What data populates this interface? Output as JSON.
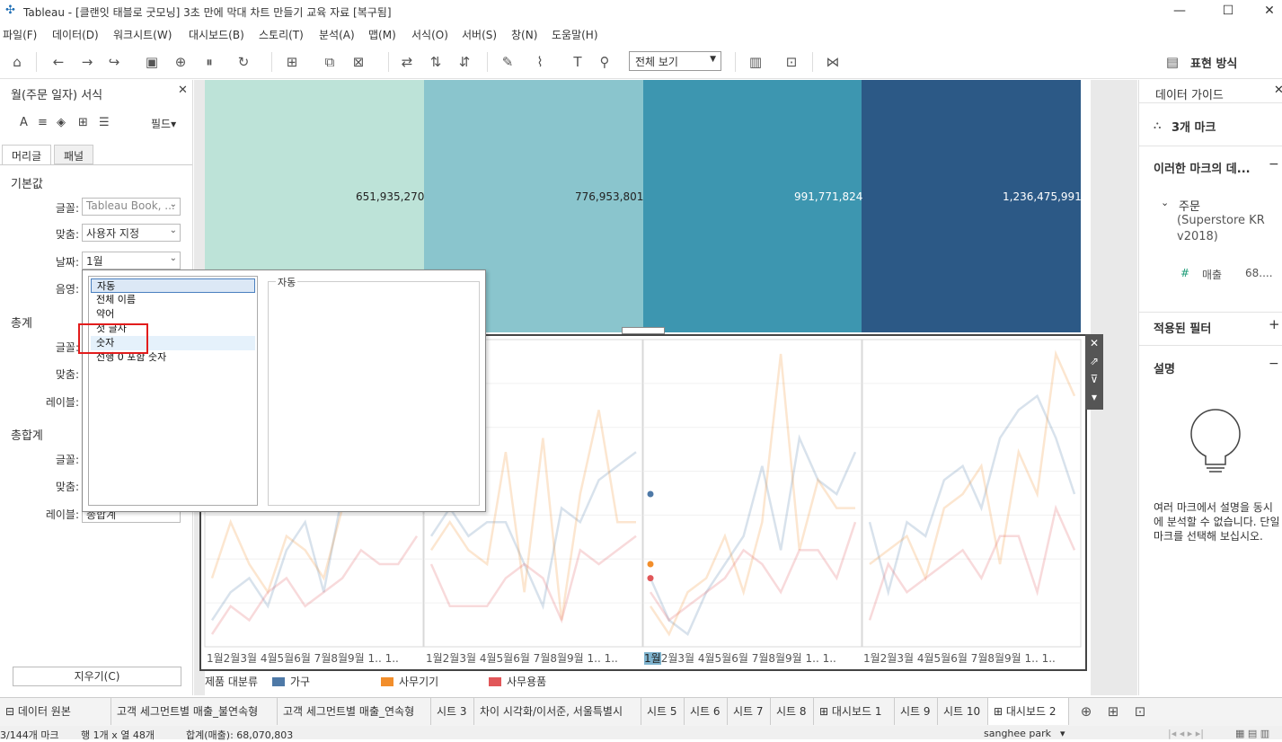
{
  "window": {
    "title": "Tableau - [클랜잇 태블로 굿모닝] 3초 만에 막대 차트 만들기 교육 자료 [복구됨]",
    "minimize": "—",
    "maximize": "☐",
    "close": "✕"
  },
  "menu": [
    "파일(F)",
    "데이터(D)",
    "워크시트(W)",
    "대시보드(B)",
    "스토리(T)",
    "분석(A)",
    "맵(M)",
    "서식(O)",
    "서버(S)",
    "창(N)",
    "도움말(H)"
  ],
  "toolbar": {
    "view_select": "전체 보기",
    "show_me": "표현 방식",
    "icons": [
      "home-icon",
      "undo-icon",
      "redo-icon",
      "redo-forward-icon",
      "save-icon",
      "new-datasource-icon",
      "pause-icon",
      "refresh-icon",
      "new-worksheet-icon",
      "duplicate-icon",
      "clear-icon",
      "swap-icon",
      "sort-asc-icon",
      "sort-desc-icon",
      "highlight-icon",
      "group-icon",
      "label-icon",
      "pin-icon",
      "fit-icon",
      "presentation-icon",
      "share-icon"
    ]
  },
  "format_pane": {
    "title": "월(주문 일자) 서식",
    "field_button": "필드▾",
    "tabs": {
      "header": "머리글",
      "panel": "패널"
    },
    "default_section": "기본값",
    "font_label": "글꼴:",
    "font_value": "Tableau Book, ...",
    "align_label": "맞춤:",
    "align_value": "사용자 지정",
    "date_label": "날짜:",
    "date_value": "1월",
    "shading_label": "음영:",
    "totals_section": "총계",
    "totals_font_label": "글꼴:",
    "totals_align_label": "맞춤:",
    "totals_label_label": "레이블:",
    "grand_section": "총합계",
    "grand_font_label": "글꼴:",
    "grand_align_label": "맞춤:",
    "grand_label_label": "레이블:",
    "grand_label_value": "총합계",
    "clear_button": "지우기(C)"
  },
  "date_dropdown": {
    "options": [
      "자동",
      "전체 이름",
      "약어",
      "첫 글자",
      "숫자",
      "선행 0 포함 숫자"
    ],
    "selected": "자동",
    "preview_caption": "자동"
  },
  "bar_chart": {
    "labels": [
      "651,935,270",
      "776,953,801",
      "991,771,824",
      "1,236,475,991"
    ],
    "colors": [
      "#bde3d8",
      "#8ac5cd",
      "#3d96b0",
      "#2c5986"
    ]
  },
  "chart_data": {
    "type": "line",
    "categories": [
      "1월",
      "2월",
      "3월",
      "4월",
      "5월",
      "6월",
      "7월",
      "8월",
      "9월",
      "1..",
      "1..",
      "1.."
    ],
    "panes": 4,
    "series": [
      {
        "name": "가구",
        "values": [
          [
            1,
            3,
            4,
            2,
            6,
            8,
            3,
            10,
            9,
            12,
            13,
            15
          ],
          [
            7,
            9,
            7,
            8,
            8,
            5,
            2,
            9,
            8,
            11,
            12,
            13
          ],
          [
            4,
            1,
            0,
            3,
            5,
            7,
            12,
            6,
            14,
            11,
            10,
            13
          ],
          [
            8,
            3,
            8,
            7,
            11,
            12,
            9,
            14,
            16,
            17,
            14,
            10
          ]
        ]
      },
      {
        "name": "사무기기",
        "values": [
          [
            4,
            8,
            5,
            3,
            7,
            6,
            4,
            9,
            10,
            14,
            15,
            18
          ],
          [
            6,
            8,
            6,
            5,
            13,
            3,
            14,
            1,
            10,
            16,
            8,
            8
          ],
          [
            2,
            0,
            3,
            4,
            7,
            3,
            8,
            20,
            6,
            11,
            9,
            9
          ],
          [
            5,
            6,
            7,
            4,
            9,
            10,
            12,
            5,
            13,
            10,
            20,
            17
          ]
        ]
      },
      {
        "name": "사무용품",
        "values": [
          [
            0,
            2,
            1,
            3,
            4,
            2,
            3,
            4,
            6,
            5,
            5,
            7
          ],
          [
            5,
            2,
            2,
            2,
            4,
            5,
            4,
            1,
            6,
            5,
            6,
            7
          ],
          [
            3,
            1,
            2,
            3,
            4,
            6,
            5,
            3,
            6,
            6,
            4,
            8
          ],
          [
            1,
            5,
            3,
            4,
            5,
            6,
            4,
            7,
            7,
            3,
            9,
            6
          ]
        ]
      }
    ],
    "highlight_values": {
      "가구": 10,
      "사무기기": 5,
      "사무용품": 4
    },
    "legend_title": "제품 대분류",
    "legend": [
      "가구",
      "사무기기",
      "사무용품"
    ]
  },
  "data_guide": {
    "title": "데이터 가이드",
    "marks": "3개 마크",
    "section_marks": "이러한 마크의 데...",
    "source_name": "주문",
    "source_detail": "(Superstore KR v2018)",
    "field_name": "매출",
    "field_value": "68....",
    "filters": "적용된 필터",
    "description": "설명",
    "description_text": "여러 마크에서 설명을 동시에 분석할 수 없습니다. 단일 마크를 선택해 보십시오."
  },
  "sheet_tabs": [
    "데이터 원본",
    "고객 세그먼트별 매출_불연속형",
    "고객 세그먼트별 매출_연속형",
    "시트 3",
    "차이 시각화/이서준, 서울특별시",
    "시트 5",
    "시트 6",
    "시트 7",
    "시트 8",
    "대시보드 1",
    "시트 9",
    "시트 10",
    "대시보드 2"
  ],
  "status": {
    "marks": "3/144개 마크",
    "rows": "행 1개 x 열 48개",
    "sum": "합계(매출): 68,070,803",
    "user": "sanghee park"
  },
  "colors": {
    "furniture": "#4e79a7",
    "office_machines": "#f28e2b",
    "office_supplies": "#e15759",
    "highlight_red": "#e21c1c"
  }
}
